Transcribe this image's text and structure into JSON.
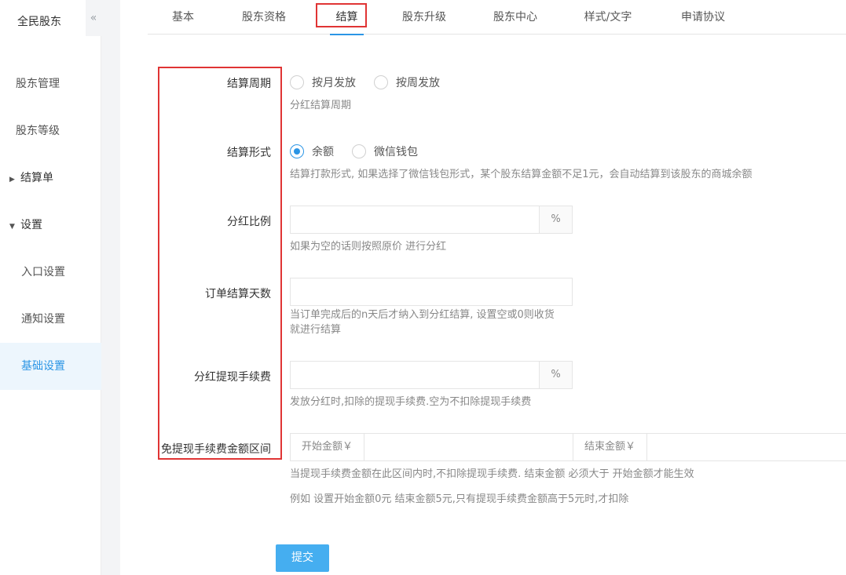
{
  "sidebar": {
    "brand": "全民股东",
    "collapse_glyph": "«",
    "items": [
      {
        "label": "股东管理"
      },
      {
        "label": "股东等级"
      },
      {
        "label": "结算单",
        "caret": "▶"
      },
      {
        "label": "设置",
        "caret": "▼"
      },
      {
        "label": "入口设置"
      },
      {
        "label": "通知设置"
      },
      {
        "label": "基础设置"
      }
    ]
  },
  "tabs": [
    {
      "label": "基本"
    },
    {
      "label": "股东资格"
    },
    {
      "label": "结算"
    },
    {
      "label": "股东升级"
    },
    {
      "label": "股东中心"
    },
    {
      "label": "样式/文字"
    },
    {
      "label": "申请协议"
    }
  ],
  "form": {
    "cycle": {
      "label": "结算周期",
      "options": [
        "按月发放",
        "按周发放"
      ],
      "help": "分红结算周期"
    },
    "method": {
      "label": "结算形式",
      "options": [
        "余额",
        "微信钱包"
      ],
      "selected": "余额",
      "help": "结算打款形式, 如果选择了微信钱包形式，某个股东结算金额不足1元，会自动结算到该股东的商城余额"
    },
    "ratio": {
      "label": "分红比例",
      "value": "",
      "addon": "%",
      "help": "如果为空的话则按照原价 进行分红"
    },
    "days": {
      "label": "订单结算天数",
      "value": "",
      "help_line1": "当订单完成后的n天后才纳入到分红结算, 设置空或0则收货",
      "help_line2": "就进行结算"
    },
    "fee": {
      "label": "分红提现手续费",
      "value": "",
      "addon": "%",
      "help": "发放分红时,扣除的提现手续费.空为不扣除提现手续费"
    },
    "free_range": {
      "label": "免提现手续费金额区间",
      "start_addon": "开始金额￥",
      "start_value": "",
      "end_addon": "结束金额￥",
      "end_value": "",
      "help_line1": "当提现手续费金额在此区间内时,不扣除提现手续费. 结束金额 必须大于 开始金额才能生效",
      "help_line2": "例如 设置开始金额0元 结束金额5元,只有提现手续费金额高于5元时,才扣除"
    },
    "submit_label": "提交"
  },
  "colors": {
    "accent": "#2b95e5",
    "highlight": "#e03434",
    "submit": "#45aef0"
  }
}
